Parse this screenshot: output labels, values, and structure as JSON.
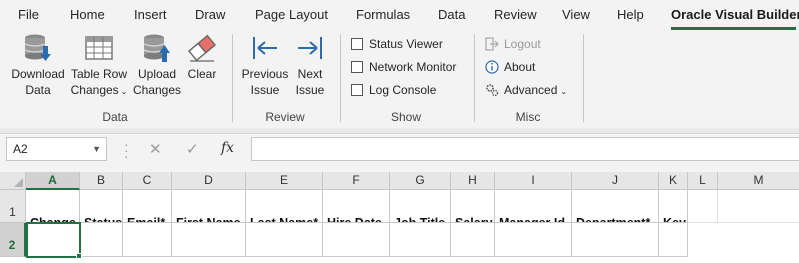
{
  "tabs": [
    {
      "label": "File"
    },
    {
      "label": "Home"
    },
    {
      "label": "Insert"
    },
    {
      "label": "Draw"
    },
    {
      "label": "Page Layout"
    },
    {
      "label": "Formulas"
    },
    {
      "label": "Data"
    },
    {
      "label": "Review"
    },
    {
      "label": "View"
    },
    {
      "label": "Help"
    },
    {
      "label": "Oracle Visual Builder"
    }
  ],
  "ribbon": {
    "data_group": {
      "label": "Data",
      "buttons": [
        {
          "line1": "Download",
          "line2": "Data",
          "icon": "database-download-icon"
        },
        {
          "line1": "Table Row",
          "line2": "Changes",
          "icon": "table-grid-icon",
          "has_dropdown": true
        },
        {
          "line1": "Upload",
          "line2": "Changes",
          "icon": "database-upload-icon"
        },
        {
          "line1": "Clear",
          "line2": "",
          "icon": "eraser-icon"
        }
      ]
    },
    "review_group": {
      "label": "Review",
      "buttons": [
        {
          "line1": "Previous",
          "line2": "Issue",
          "icon": "arrow-left-icon"
        },
        {
          "line1": "Next",
          "line2": "Issue",
          "icon": "arrow-right-icon"
        }
      ]
    },
    "show_group": {
      "label": "Show",
      "checkboxes": [
        {
          "label": "Status Viewer",
          "checked": false
        },
        {
          "label": "Network Monitor",
          "checked": false
        },
        {
          "label": "Log Console",
          "checked": false
        }
      ]
    },
    "misc_group": {
      "label": "Misc",
      "items": [
        {
          "label": "Logout",
          "icon": "logout-icon",
          "disabled": true
        },
        {
          "label": "About",
          "icon": "info-icon",
          "disabled": false
        },
        {
          "label": "Advanced",
          "icon": "gears-icon",
          "disabled": false,
          "has_dropdown": true
        }
      ]
    }
  },
  "formula_bar": {
    "name_box": "A2",
    "fx_label": "fx",
    "cancel_glyph": "✕",
    "enter_glyph": "✓",
    "value": ""
  },
  "sheet": {
    "columns": [
      "A",
      "B",
      "C",
      "D",
      "E",
      "F",
      "G",
      "H",
      "I",
      "J",
      "K",
      "L",
      "M"
    ],
    "rows": [
      "1",
      "2"
    ],
    "header_row": [
      "Change",
      "Status",
      "Email*",
      "First Name",
      "Last Name*",
      "Hire Date",
      "Job Title",
      "Salary",
      "Manager Id",
      "Department*",
      "Key"
    ],
    "active_cell": "A2"
  },
  "colors": {
    "accent": "#217346",
    "accent_blue": "#2b6cb0"
  }
}
